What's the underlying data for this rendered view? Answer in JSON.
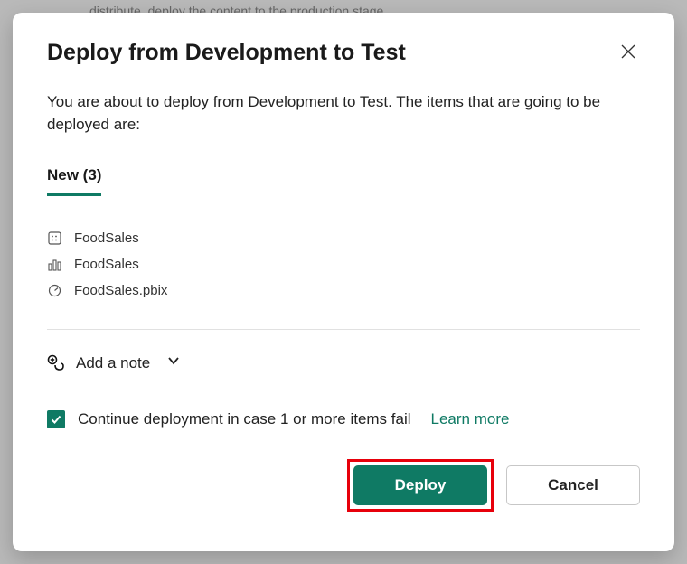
{
  "backdrop": {
    "text_fragment": "distribute, deploy the content to the production stage"
  },
  "modal": {
    "title": "Deploy from Development to Test",
    "description": "You are about to deploy from Development to Test. The items that are going to be deployed are:",
    "tab_label": "New (3)",
    "items": [
      {
        "icon": "dataset-icon",
        "name": "FoodSales"
      },
      {
        "icon": "report-icon",
        "name": "FoodSales"
      },
      {
        "icon": "dashboard-icon",
        "name": "FoodSales.pbix"
      }
    ],
    "add_note_label": "Add a note",
    "checkbox": {
      "checked": true,
      "label": "Continue deployment in case 1 or more items fail",
      "learn_more": "Learn more"
    },
    "buttons": {
      "deploy": "Deploy",
      "cancel": "Cancel"
    }
  }
}
